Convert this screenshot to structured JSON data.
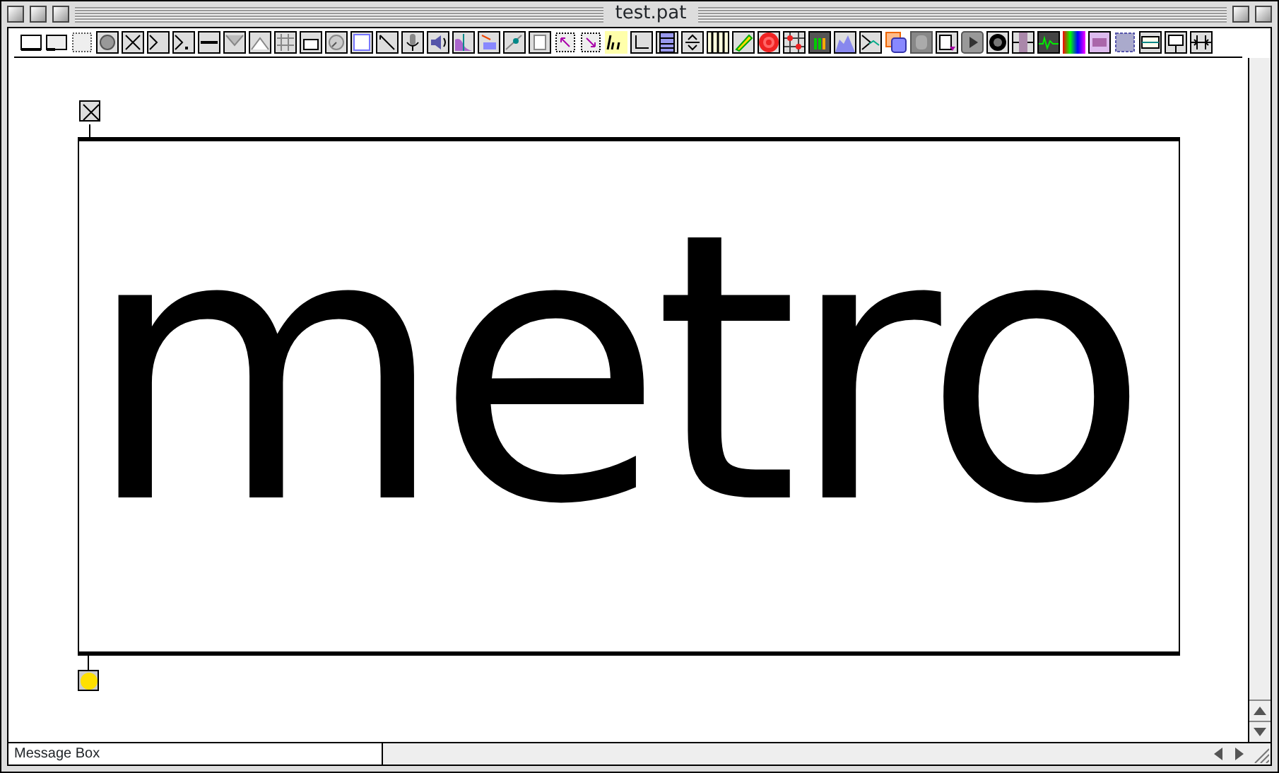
{
  "window": {
    "title": "test.pat"
  },
  "patch": {
    "toggle": {
      "checked": true
    },
    "object": {
      "text": "metro"
    },
    "bang": {
      "lit": true
    }
  },
  "status_bar": {
    "text": "Message Box"
  }
}
